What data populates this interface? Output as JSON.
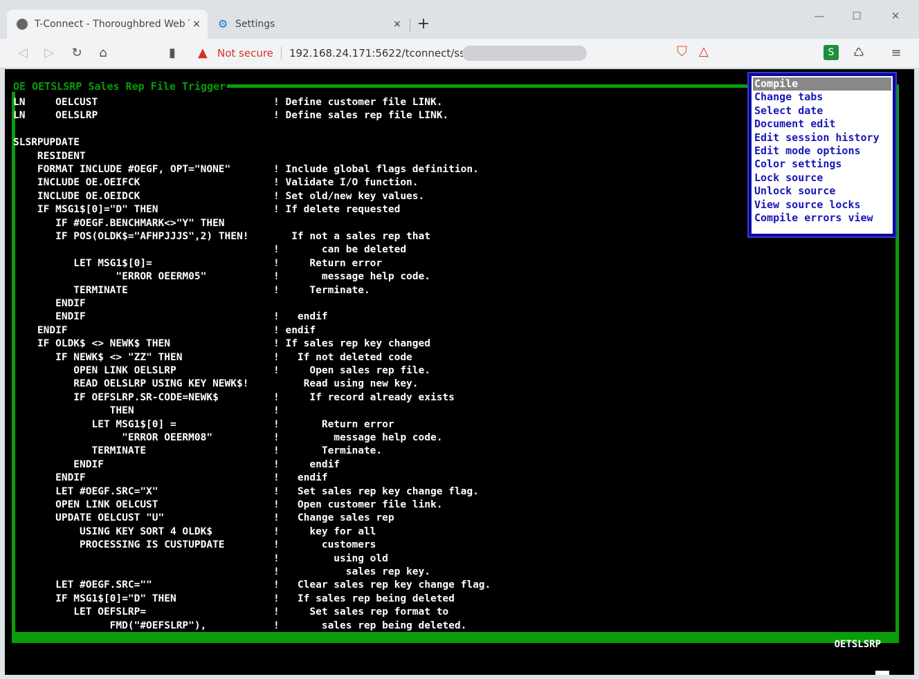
{
  "browser": {
    "tabs": [
      {
        "title": "T-Connect - Thoroughbred Web Te",
        "active": true,
        "close": "×"
      },
      {
        "title": "Settings",
        "active": false,
        "close": "×"
      }
    ],
    "new_tab": "+",
    "window_controls": [
      "—",
      "☐",
      "✕"
    ],
    "address": {
      "security_label": "Not secure",
      "url": "192.168.24.171:5622/tconnect/ssh"
    }
  },
  "terminal": {
    "title": "OE OETSLSRP Sales Rep File Trigger",
    "status_program": "OETSLSRP",
    "code_lines": [
      [
        "LN     OELCUST",
        "! Define customer file LINK."
      ],
      [
        "LN     OELSLRP",
        "! Define sales rep file LINK."
      ],
      [
        "",
        ""
      ],
      [
        "SLSRPUPDATE",
        ""
      ],
      [
        "    RESIDENT",
        ""
      ],
      [
        "    FORMAT INCLUDE #OEGF, OPT=\"NONE\"",
        "! Include global flags definition."
      ],
      [
        "    INCLUDE OE.OEIFCK",
        "! Validate I/O function."
      ],
      [
        "    INCLUDE OE.OEIDCK",
        "! Set old/new key values."
      ],
      [
        "    IF MSG1$[0]=\"D\" THEN",
        "! If delete requested"
      ],
      [
        "       IF #OEGF.BENCHMARK<>\"Y\" THEN",
        ""
      ],
      [
        "       IF POS(OLDK$=\"AFHPJJJS\",2) THEN!",
        "   If not a sales rep that"
      ],
      [
        "",
        "!       can be deleted"
      ],
      [
        "          LET MSG1$[0]=",
        "!     Return error"
      ],
      [
        "                 \"ERROR OEERM05\"",
        "!       message help code."
      ],
      [
        "          TERMINATE",
        "!     Terminate."
      ],
      [
        "       ENDIF",
        ""
      ],
      [
        "       ENDIF",
        "!   endif"
      ],
      [
        "    ENDIF",
        "! endif"
      ],
      [
        "    IF OLDK$ <> NEWK$ THEN",
        "! If sales rep key changed"
      ],
      [
        "       IF NEWK$ <> \"ZZ\" THEN",
        "!   If not deleted code"
      ],
      [
        "          OPEN LINK OELSLRP",
        "!     Open sales rep file."
      ],
      [
        "          READ OELSLRP USING KEY NEWK$!",
        "     Read using new key."
      ],
      [
        "          IF OEFSLRP.SR-CODE=NEWK$",
        "!     If record already exists"
      ],
      [
        "                THEN",
        "!"
      ],
      [
        "             LET MSG1$[0] =",
        "!       Return error"
      ],
      [
        "                  \"ERROR OEERM08\"",
        "!         message help code."
      ],
      [
        "             TERMINATE",
        "!       Terminate."
      ],
      [
        "          ENDIF",
        "!     endif"
      ],
      [
        "       ENDIF",
        "!   endif"
      ],
      [
        "       LET #OEGF.SRC=\"X\"",
        "!   Set sales rep key change flag."
      ],
      [
        "       OPEN LINK OELCUST",
        "!   Open customer file link."
      ],
      [
        "       UPDATE OELCUST \"U\"",
        "!   Change sales rep"
      ],
      [
        "           USING KEY SORT 4 OLDK$",
        "!     key for all"
      ],
      [
        "           PROCESSING IS CUSTUPDATE",
        "!       customers"
      ],
      [
        "",
        "!         using old"
      ],
      [
        "",
        "!           sales rep key."
      ],
      [
        "       LET #OEGF.SRC=\"\"",
        "!   Clear sales rep key change flag."
      ],
      [
        "       IF MSG1$[0]=\"D\" THEN",
        "!   If sales rep being deleted"
      ],
      [
        "          LET OEFSLRP=",
        "!     Set sales rep format to"
      ],
      [
        "                FMD(\"#OEFSLRP\"),",
        "!       sales rep being deleted."
      ]
    ]
  },
  "menu": {
    "items": [
      {
        "label": "Compile",
        "selected": true
      },
      {
        "label": "Change tabs",
        "selected": false
      },
      {
        "label": "Select date",
        "selected": false
      },
      {
        "label": "Document edit",
        "selected": false
      },
      {
        "label": "Edit session history",
        "selected": false
      },
      {
        "label": "Edit mode options",
        "selected": false
      },
      {
        "label": "Color settings",
        "selected": false
      },
      {
        "label": "Lock source",
        "selected": false
      },
      {
        "label": "Unlock source",
        "selected": false
      },
      {
        "label": "View source locks",
        "selected": false
      },
      {
        "label": "Compile errors view",
        "selected": false
      }
    ]
  },
  "colors": {
    "terminal_bg": "#000000",
    "border_green": "#0a9c0a",
    "menu_text": "#1717b8",
    "menu_border": "#0a0a9c",
    "warning_red": "#d93025"
  }
}
